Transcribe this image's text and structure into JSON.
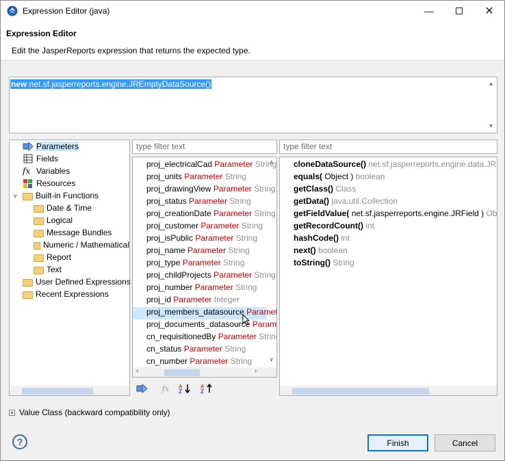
{
  "window": {
    "title": "Expression Editor (java)"
  },
  "header": {
    "title": "Expression Editor",
    "description": "Edit the JasperReports expression that returns the expected type."
  },
  "editor": {
    "keyword": "new",
    "expression": " net.sf.jasperreports.engine.JREmptyDataSource()"
  },
  "categories": {
    "items": [
      {
        "label": "Parameters",
        "icon": "parameters-icon"
      },
      {
        "label": "Fields",
        "icon": "fields-icon"
      },
      {
        "label": "Variables",
        "icon": "variables-icon"
      },
      {
        "label": "Resources",
        "icon": "resources-icon"
      },
      {
        "label": "Built-in Functions",
        "icon": "folder-icon"
      },
      {
        "label": "Date & Time",
        "icon": "folder-icon"
      },
      {
        "label": "Logical",
        "icon": "folder-icon"
      },
      {
        "label": "Message Bundles",
        "icon": "folder-icon"
      },
      {
        "label": "Numeric / Mathematical",
        "icon": "folder-icon"
      },
      {
        "label": "Report",
        "icon": "folder-icon"
      },
      {
        "label": "Text",
        "icon": "folder-icon"
      },
      {
        "label": "User Defined Expressions",
        "icon": "folder-icon"
      },
      {
        "label": "Recent Expressions",
        "icon": "folder-icon"
      }
    ],
    "selected": "Parameters"
  },
  "filters": {
    "middle_placeholder": "type filter text",
    "right_placeholder": "type filter text"
  },
  "elements": [
    {
      "name": "proj_electricalCad",
      "kind": "Parameter",
      "type": "String"
    },
    {
      "name": "proj_units",
      "kind": "Parameter",
      "type": "String"
    },
    {
      "name": "proj_drawingView",
      "kind": "Parameter",
      "type": "String"
    },
    {
      "name": "proj_status",
      "kind": "Parameter",
      "type": "String"
    },
    {
      "name": "proj_creationDate",
      "kind": "Parameter",
      "type": "String"
    },
    {
      "name": "proj_customer",
      "kind": "Parameter",
      "type": "String"
    },
    {
      "name": "proj_isPublic",
      "kind": "Parameter",
      "type": "String"
    },
    {
      "name": "proj_name",
      "kind": "Parameter",
      "type": "String"
    },
    {
      "name": "proj_type",
      "kind": "Parameter",
      "type": "String"
    },
    {
      "name": "proj_childProjects",
      "kind": "Parameter",
      "type": "String"
    },
    {
      "name": "proj_number",
      "kind": "Parameter",
      "type": "String"
    },
    {
      "name": "proj_id",
      "kind": "Parameter",
      "type": "Integer"
    },
    {
      "name": "proj_members_datasource",
      "kind": "Parameter",
      "type": ""
    },
    {
      "name": "proj_documents_datasource",
      "kind": "Parameter",
      "type": ""
    },
    {
      "name": "cn_requisitionedBy",
      "kind": "Parameter",
      "type": "String"
    },
    {
      "name": "cn_status",
      "kind": "Parameter",
      "type": "String"
    },
    {
      "name": "cn_number",
      "kind": "Parameter",
      "type": "String"
    }
  ],
  "methods": [
    {
      "name": "cloneDataSource()",
      "ret": "net.sf.jasperreports.engine.data.JRBe"
    },
    {
      "name": "equals(",
      "args": " Object )",
      "ret": "boolean"
    },
    {
      "name": "getClass()",
      "ret": "Class"
    },
    {
      "name": "getData()",
      "ret": "java.util.Collection"
    },
    {
      "name": "getFieldValue(",
      "args": " net.sf.jasperreports.engine.JRField )",
      "ret": "Obje"
    },
    {
      "name": "getRecordCount()",
      "ret": "int"
    },
    {
      "name": "hashCode()",
      "ret": "int"
    },
    {
      "name": "next()",
      "ret": "boolean"
    },
    {
      "name": "toString()",
      "ret": "String"
    }
  ],
  "value_class": {
    "label": "Value Class (backward compatibility only)"
  },
  "buttons": {
    "finish": "Finish",
    "cancel": "Cancel",
    "help": "?"
  }
}
